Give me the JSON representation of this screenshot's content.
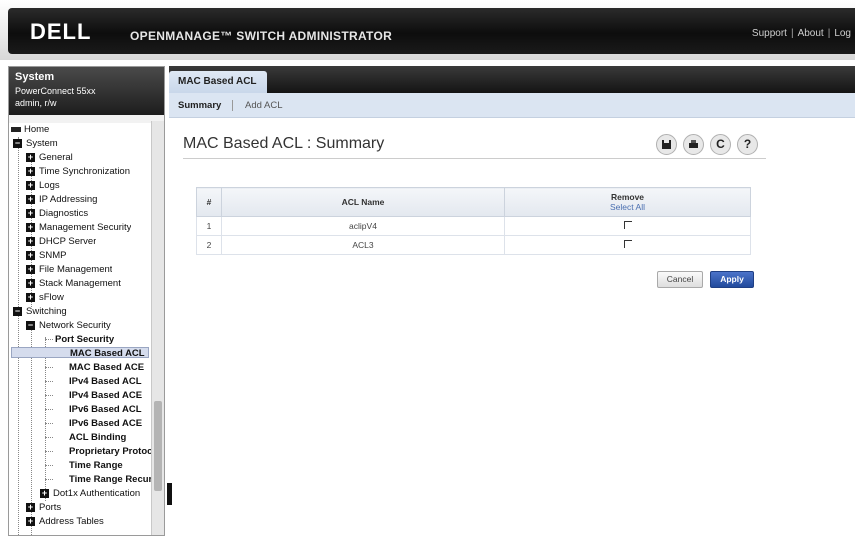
{
  "header": {
    "logo": "DELL",
    "app_title": "OPENMANAGE™ SWITCH ADMINISTRATOR",
    "links": [
      "Support",
      "About",
      "Log"
    ]
  },
  "system": {
    "title": "System",
    "model": "PowerConnect 55xx",
    "user": "admin, r/w"
  },
  "tree": {
    "home": "Home",
    "system": "System",
    "system_items": [
      "General",
      "Time Synchronization",
      "Logs",
      "IP Addressing",
      "Diagnostics",
      "Management Security",
      "DHCP Server",
      "SNMP",
      "File Management",
      "Stack Management",
      "sFlow"
    ],
    "switching": "Switching",
    "network_security": "Network Security",
    "ns_items": [
      "Port Security",
      "MAC Based ACL",
      "MAC Based ACE",
      "IPv4 Based ACL",
      "IPv4 Based ACE",
      "IPv6 Based ACL",
      "IPv6 Based ACE",
      "ACL Binding",
      "Proprietary Protocol",
      "Time Range",
      "Time Range Recurring"
    ],
    "dot1x": "Dot1x Authentication",
    "ports": "Ports",
    "address_tables": "Address Tables"
  },
  "tabs": {
    "main": "MAC Based ACL",
    "summary": "Summary",
    "add": "Add ACL"
  },
  "page": {
    "title": "MAC Based ACL : Summary"
  },
  "toolbar_icons": [
    "save-icon",
    "print-icon",
    "refresh-icon",
    "help-icon"
  ],
  "table": {
    "col_num": "#",
    "col_name": "ACL Name",
    "col_remove": "Remove",
    "select_all": "Select All",
    "rows": [
      {
        "num": "1",
        "name": "aclipV4"
      },
      {
        "num": "2",
        "name": "ACL3"
      }
    ]
  },
  "buttons": {
    "cancel": "Cancel",
    "apply": "Apply"
  },
  "colors": {
    "accent": "#214a9c",
    "selected_row": "#d5dced"
  }
}
